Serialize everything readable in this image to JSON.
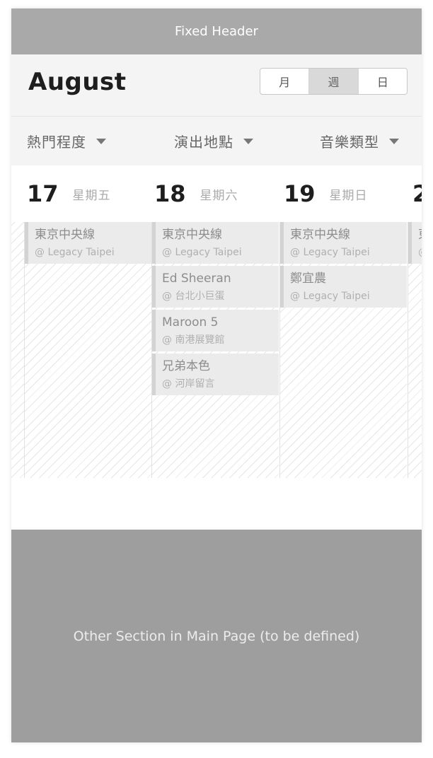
{
  "fixed_header": {
    "label": "Fixed Header"
  },
  "month": {
    "title": "August"
  },
  "view_switch": {
    "month": "月",
    "week": "週",
    "day": "日",
    "active": "week"
  },
  "filters": {
    "popularity": "熱門程度",
    "venue": "演出地點",
    "genre": "音樂類型"
  },
  "days": [
    {
      "num": "17",
      "weekday": "星期五"
    },
    {
      "num": "18",
      "weekday": "星期六"
    },
    {
      "num": "19",
      "weekday": "星期日"
    },
    {
      "num": "2",
      "weekday": ""
    }
  ],
  "events": {
    "col0": [
      {
        "title": "東京中央線",
        "place": "@ Legacy Taipei"
      }
    ],
    "col1": [
      {
        "title": "東京中央線",
        "place": "@ Legacy Taipei"
      },
      {
        "title": "Ed Sheeran",
        "place": "@ 台北小巨蛋"
      },
      {
        "title": "Maroon 5",
        "place": "@ 南港展覽館"
      },
      {
        "title": "兄弟本色",
        "place": "@ 河岸留言"
      }
    ],
    "col2": [
      {
        "title": "東京中央線",
        "place": "@ Legacy Taipei"
      },
      {
        "title": "鄭宜農",
        "place": "@ Legacy Taipei"
      }
    ],
    "col3": [
      {
        "title": "東",
        "place": "@"
      }
    ]
  },
  "other_section": {
    "label": "Other Section in Main Page (to be defined)"
  }
}
